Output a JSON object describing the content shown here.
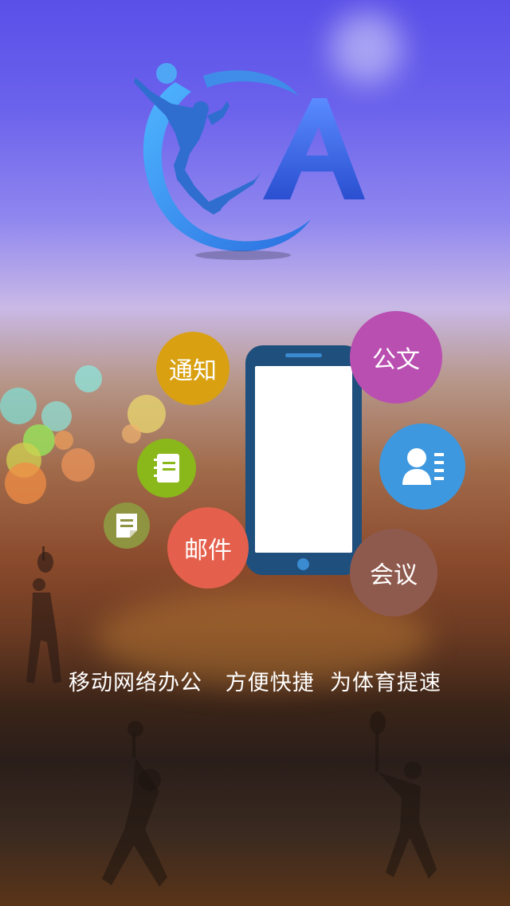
{
  "bubbles": {
    "notice": "通知",
    "document": "公文",
    "mail": "邮件",
    "meeting": "会议"
  },
  "icons": {
    "notebook": "notebook-icon",
    "note": "note-icon",
    "contacts": "contacts-icon"
  },
  "slogan": "移动网络办公   方便快捷  为体育提速",
  "colors": {
    "notice": "#d9a012",
    "document": "#b94fb1",
    "mail": "#e4604c",
    "meeting": "#8f5a4e",
    "contacts": "#3d98e0",
    "notebook": "#8ab81a",
    "note": "#8f9440",
    "phone": "#1f4f7c"
  }
}
